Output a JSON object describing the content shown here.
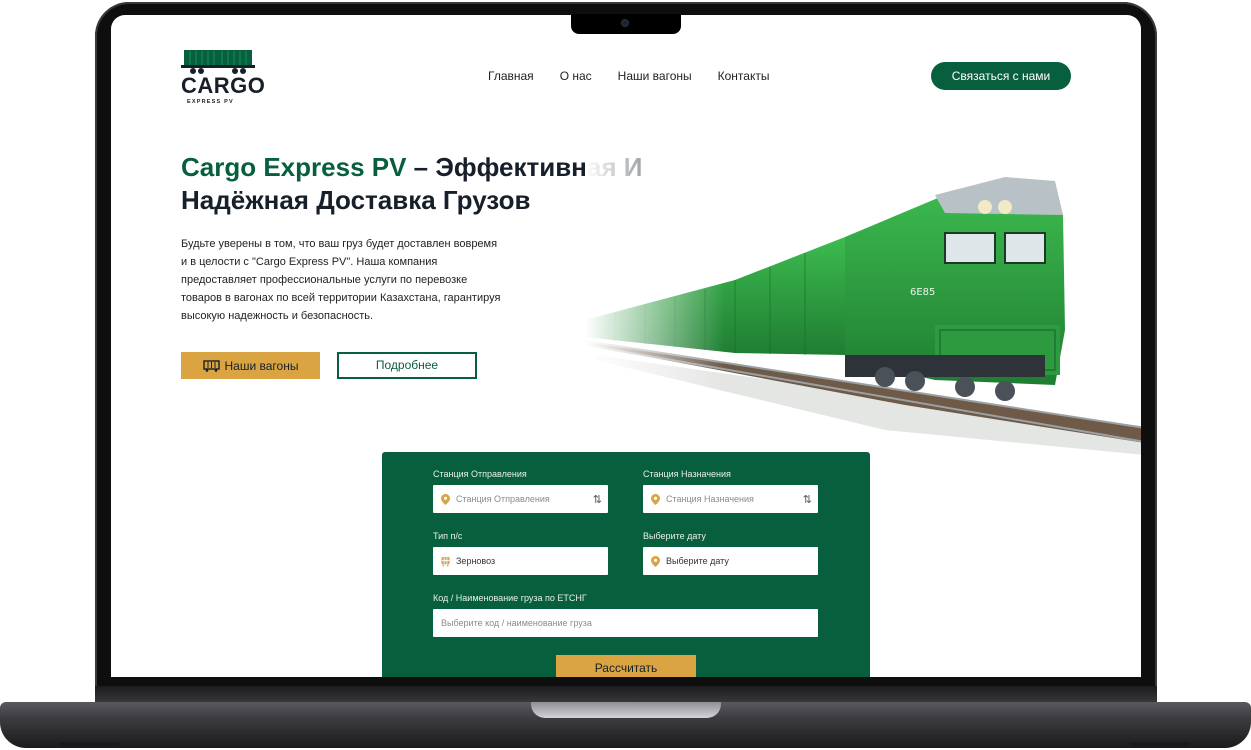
{
  "header": {
    "logo_text": "CARGO",
    "logo_subtitle": "EXPRESS PV",
    "nav": [
      "Главная",
      "О нас",
      "Наши вагоны",
      "Контакты"
    ],
    "contact_button": "Связаться с нами"
  },
  "hero": {
    "title_accent": "Cargo Express PV",
    "title_rest": " – Эффективная И Надёжная Доставка Грузов",
    "description": "Будьте уверены в том, что ваш груз будет доставлен вовремя и в целости с \"Cargo Express PV\". Наша компания предоставляет профессиональные услуги по перевозке товаров в вагонах по всей территории Казахстана, гарантируя высокую надежность и безопасность.",
    "primary_button": "Наши вагоны",
    "secondary_button": "Подробнее",
    "train_number": "6E85"
  },
  "calculator": {
    "departure_label": "Станция Отправления",
    "departure_placeholder": "Станция Отправления",
    "destination_label": "Станция Назначения",
    "destination_placeholder": "Станция Назначения",
    "wagon_type_label": "Тип п/с",
    "wagon_type_value": "Зерновоз",
    "date_label": "Выберите дату",
    "date_value": "Выберите дату",
    "cargo_label": "Код / Наименование груза по ЕТСНГ",
    "cargo_placeholder": "Выберите код / наименование груза",
    "submit_button": "Рассчитать"
  },
  "colors": {
    "brand_green": "#075f3e",
    "accent_gold": "#d9a441",
    "text_dark": "#17202a"
  }
}
